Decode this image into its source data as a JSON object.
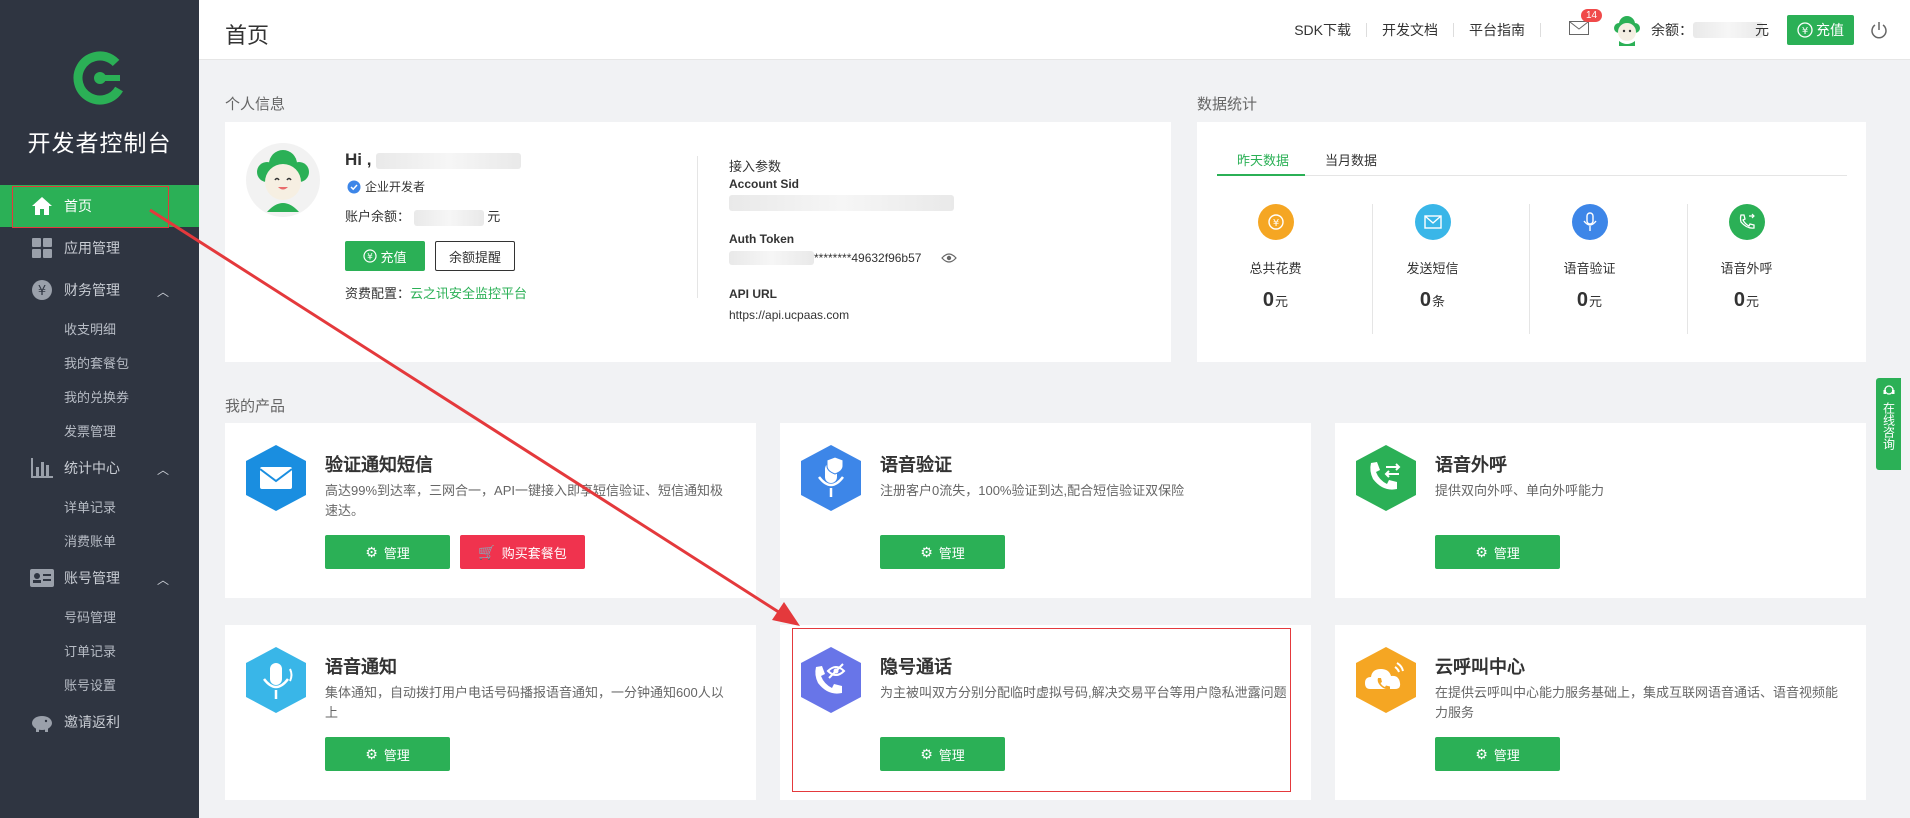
{
  "sidebar": {
    "title": "开发者控制台",
    "items": [
      {
        "label": "首页"
      },
      {
        "label": "应用管理"
      },
      {
        "label": "财务管理"
      },
      {
        "label": "收支明细"
      },
      {
        "label": "我的套餐包"
      },
      {
        "label": "我的兑换券"
      },
      {
        "label": "发票管理"
      },
      {
        "label": "统计中心"
      },
      {
        "label": "详单记录"
      },
      {
        "label": "消费账单"
      },
      {
        "label": "账号管理"
      },
      {
        "label": "号码管理"
      },
      {
        "label": "订单记录"
      },
      {
        "label": "账号设置"
      },
      {
        "label": "邀请返利"
      }
    ]
  },
  "header": {
    "title": "首页",
    "links": [
      "SDK下载",
      "开发文档",
      "平台指南"
    ],
    "mail_count": "14",
    "balance_label": "余额：",
    "balance_unit": "元",
    "recharge": "充值"
  },
  "personal": {
    "section": "个人信息",
    "hi": "Hi ,",
    "dev_type": "企业开发者",
    "balance_label": "账户余额：",
    "balance_unit": "元",
    "recharge_btn": "充值",
    "reminder_btn": "余额提醒",
    "fee_label": "资费配置：",
    "fee_value": "云之讯安全监控平台",
    "params_title": "接入参数",
    "sid_label": "Account Sid",
    "token_label": "Auth Token",
    "token_value": "********49632f96b57",
    "api_label": "API URL",
    "api_value": "https://api.ucpaas.com"
  },
  "stats": {
    "section": "数据统计",
    "tabs": [
      "昨天数据",
      "当月数据"
    ],
    "items": [
      {
        "name": "总共花费",
        "value": "0",
        "unit": "元",
        "color": "#f5a623"
      },
      {
        "name": "发送短信",
        "value": "0",
        "unit": "条",
        "color": "#39b6e8"
      },
      {
        "name": "语音验证",
        "value": "0",
        "unit": "元",
        "color": "#3d86e8"
      },
      {
        "name": "语音外呼",
        "value": "0",
        "unit": "元",
        "color": "#2bb056"
      }
    ]
  },
  "products": {
    "section": "我的产品",
    "manage": "管理",
    "buy": "购买套餐包",
    "items": [
      {
        "title": "验证通知短信",
        "desc": "高达99%到达率，三网合一，API一键接入即享短信验证、短信通知极速达。",
        "icon": "mail-icon"
      },
      {
        "title": "语音验证",
        "desc": "注册客户0流失，100%验证到达,配合短信验证双保险",
        "icon": "mic-shield-icon"
      },
      {
        "title": "语音外呼",
        "desc": "提供双向外呼、单向外呼能力",
        "icon": "phone-arrows-icon"
      },
      {
        "title": "语音通知",
        "desc": "集体通知，自动拨打用户电话号码播报语音通知，一分钟通知600人以上",
        "icon": "mic-icon"
      },
      {
        "title": "隐号通话",
        "desc": "为主被叫双方分别分配临时虚拟号码,解决交易平台等用户隐私泄露问题",
        "icon": "phone-eye-icon"
      },
      {
        "title": "云呼叫中心",
        "desc": "在提供云呼叫中心能力服务基础上，集成互联网语音通话、语音视频能力服务",
        "icon": "cloud-phone-icon"
      }
    ]
  },
  "consult": "在线咨询",
  "colors": {
    "brand": "#2bb056",
    "sidebar": "#2f3541",
    "annotation": "#e4393c"
  }
}
